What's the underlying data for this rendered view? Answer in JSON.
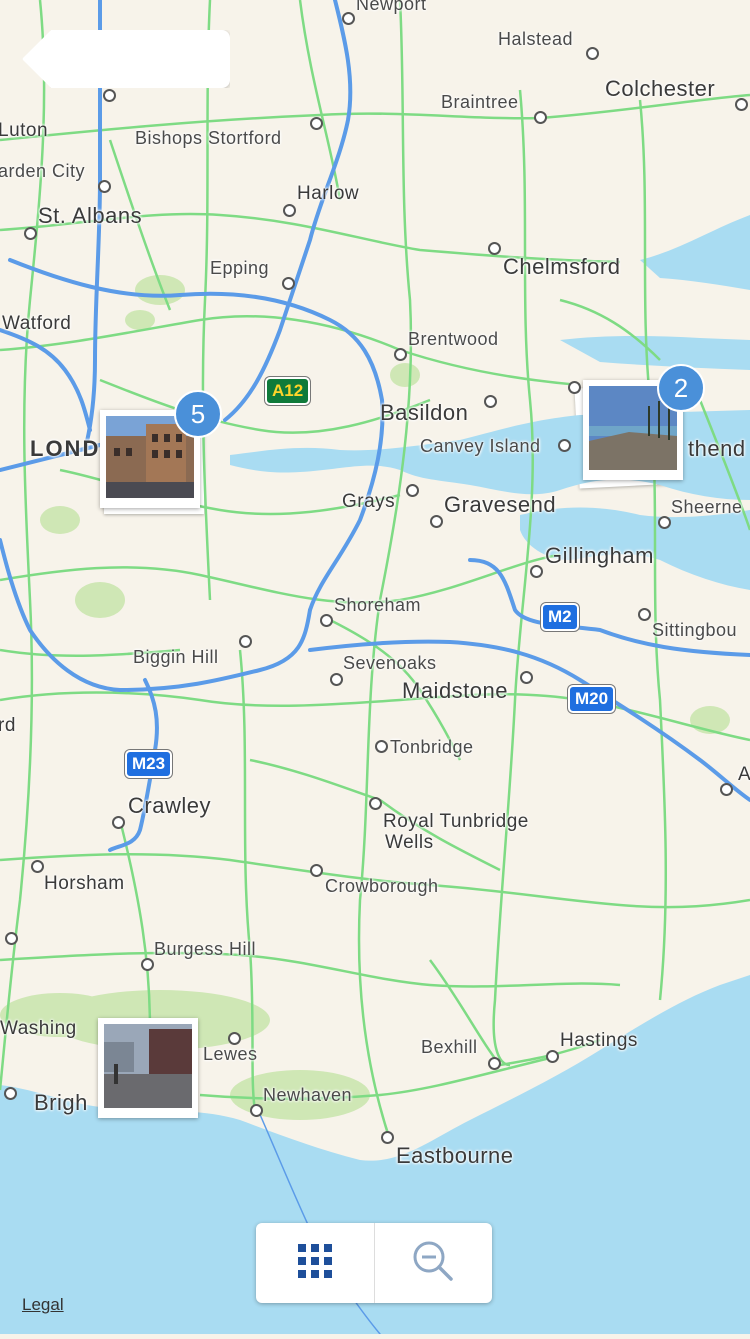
{
  "map": {
    "colors": {
      "land": "#f7f3ea",
      "water": "#a9dcf2",
      "park": "#cfe7b5",
      "road": "#7edb84",
      "motorway": "#5b9be8"
    },
    "places": [
      {
        "name": "Newport",
        "size": "sm"
      },
      {
        "name": "Halstead",
        "size": "sm"
      },
      {
        "name": "Colchester",
        "size": "big"
      },
      {
        "name": "Braintree",
        "size": "sm"
      },
      {
        "name": "Luton",
        "size": "mid"
      },
      {
        "name": "Bishops Stortford",
        "size": "sm"
      },
      {
        "name": "arden City",
        "size": "sm"
      },
      {
        "name": "Harlow",
        "size": "mid"
      },
      {
        "name": "St. Albans",
        "size": "big"
      },
      {
        "name": "Chelmsford",
        "size": "big"
      },
      {
        "name": "Epping",
        "size": "sm"
      },
      {
        "name": "Watford",
        "size": "mid"
      },
      {
        "name": "Brentwood",
        "size": "sm"
      },
      {
        "name": "Basildon",
        "size": "big"
      },
      {
        "name": "LOND",
        "size": "cap"
      },
      {
        "name": "Canvey Island",
        "size": "sm"
      },
      {
        "name": "thend",
        "size": "big"
      },
      {
        "name": "Grays",
        "size": "mid"
      },
      {
        "name": "Gravesend",
        "size": "big"
      },
      {
        "name": "Sheerne",
        "size": "sm"
      },
      {
        "name": "Gillingham",
        "size": "big"
      },
      {
        "name": "Shoreham",
        "size": "sm"
      },
      {
        "name": "Sittingbou",
        "size": "sm"
      },
      {
        "name": "Biggin Hill",
        "size": "sm"
      },
      {
        "name": "Sevenoaks",
        "size": "sm"
      },
      {
        "name": "Maidstone",
        "size": "big"
      },
      {
        "name": "rd",
        "size": "mid"
      },
      {
        "name": "Tonbridge",
        "size": "sm"
      },
      {
        "name": "A",
        "size": "mid"
      },
      {
        "name": "Crawley",
        "size": "big"
      },
      {
        "name": "Royal Tunbridge",
        "size": "mid"
      },
      {
        "name": "Wells",
        "size": "mid"
      },
      {
        "name": "Horsham",
        "size": "mid"
      },
      {
        "name": "Crowborough",
        "size": "sm"
      },
      {
        "name": "Burgess Hill",
        "size": "sm"
      },
      {
        "name": "Washing",
        "size": "mid"
      },
      {
        "name": "Lewes",
        "size": "sm"
      },
      {
        "name": "Bexhill",
        "size": "sm"
      },
      {
        "name": "Hastings",
        "size": "mid"
      },
      {
        "name": "Brigh",
        "size": "big"
      },
      {
        "name": "Newhaven",
        "size": "sm"
      },
      {
        "name": "Eastbourne",
        "size": "big"
      }
    ],
    "shields": [
      {
        "label": "A12",
        "type": "green"
      },
      {
        "label": "M2",
        "type": "blue"
      },
      {
        "label": "M20",
        "type": "blue"
      },
      {
        "label": "M23",
        "type": "blue"
      }
    ],
    "photo_clusters": [
      {
        "id": "london",
        "count": "5"
      },
      {
        "id": "southend",
        "count": "2"
      },
      {
        "id": "brighton",
        "count": ""
      }
    ]
  },
  "toolbar": {
    "grid_icon": "grid-icon",
    "zoom_out_icon": "zoom-out-icon"
  },
  "legal_label": "Legal"
}
